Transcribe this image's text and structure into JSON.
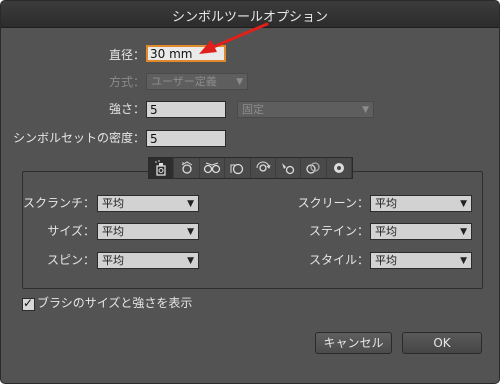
{
  "window": {
    "title": "シンボルツールオプション"
  },
  "diameter": {
    "label": "直径：",
    "value": "30 mm"
  },
  "method": {
    "label": "方式：",
    "value": "ユーザー定義"
  },
  "intensity": {
    "label": "強さ：",
    "value": "5",
    "mode": "固定"
  },
  "density": {
    "label": "シンボルセットの密度：",
    "value": "5"
  },
  "tools": [
    "symbol-sprayer-icon",
    "symbol-shifter-icon",
    "symbol-scruncher-icon",
    "symbol-sizer-icon",
    "symbol-spinner-icon",
    "symbol-stainer-icon",
    "symbol-screener-icon",
    "symbol-styler-icon"
  ],
  "left_options": [
    {
      "label": "スクランチ：",
      "value": "平均"
    },
    {
      "label": "サイズ：",
      "value": "平均"
    },
    {
      "label": "スピン：",
      "value": "平均"
    }
  ],
  "right_options": [
    {
      "label": "スクリーン：",
      "value": "平均"
    },
    {
      "label": "ステイン：",
      "value": "平均"
    },
    {
      "label": "スタイル：",
      "value": "平均"
    }
  ],
  "brush_option": {
    "label": "ブラシのサイズと強さを表示",
    "checked": true
  },
  "buttons": {
    "cancel": "キャンセル",
    "ok": "OK"
  },
  "colors": {
    "dialog_bg": "#535353",
    "focus_ring": "#e08a2c",
    "annotation_arrow": "#e0201b"
  }
}
